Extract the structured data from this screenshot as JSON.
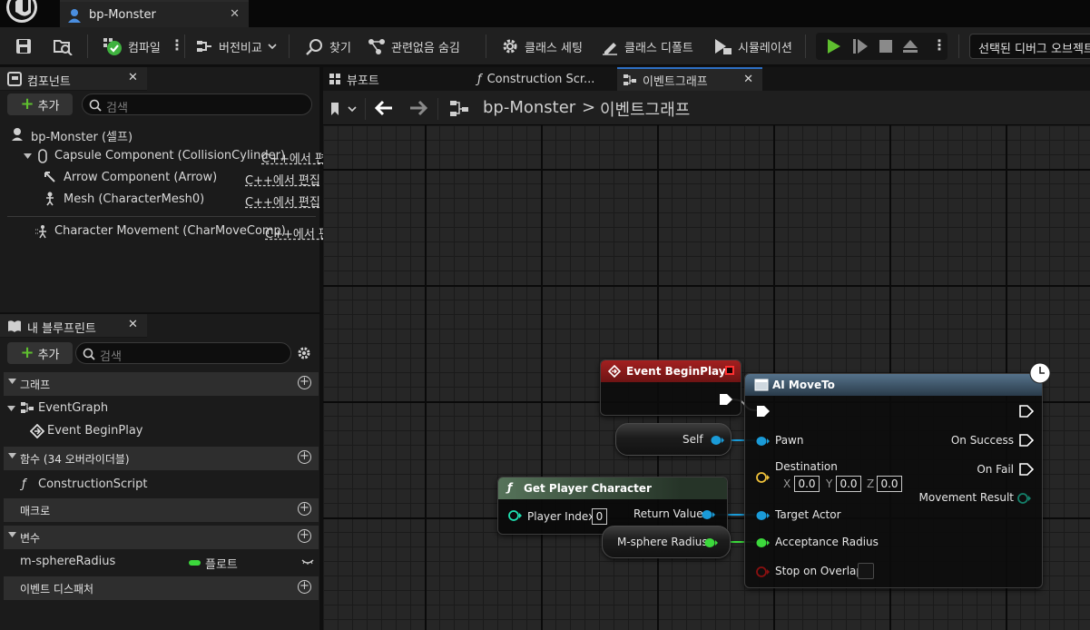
{
  "window": {
    "doc_tab": "bp-Monster"
  },
  "toolbar": {
    "compile": "컴파일",
    "diff": "버전비교",
    "find": "찾기",
    "hide_unrelated": "관련없음 숨김",
    "class_settings": "클래스 세팅",
    "class_defaults": "클래스 디폴트",
    "simulation": "시뮬레이션",
    "debug_select": "선택된 디버그 오브젝트"
  },
  "components": {
    "tab": "컴포넌트",
    "add": "추가",
    "search_placeholder": "검색",
    "items": [
      {
        "label": "bp-Monster (셀프)",
        "edit": ""
      },
      {
        "label": "Capsule Component (CollisionCylinder)",
        "edit": "C++에서 편"
      },
      {
        "label": "Arrow Component (Arrow)",
        "edit": "C++에서 편집"
      },
      {
        "label": "Mesh (CharacterMesh0)",
        "edit": "C++에서 편집"
      },
      {
        "label": "Character Movement (CharMoveComp)",
        "edit": "C++에서 편"
      }
    ]
  },
  "my_blueprint": {
    "tab": "내 블루프린트",
    "add": "추가",
    "search_placeholder": "검색",
    "sections": {
      "graphs": "그래프",
      "functions": "함수 (34 오버라이더블)",
      "macros": "매크로",
      "variables": "변수",
      "dispatchers": "이벤트 디스패처"
    },
    "graph_items": [
      "EventGraph",
      "Event BeginPlay"
    ],
    "function_items": [
      "ConstructionScript"
    ],
    "variable": {
      "name": "m-sphereRadius",
      "type": "플로트",
      "type_color": "#3cd93c"
    }
  },
  "graph_tabs": [
    "뷰포트",
    "Construction Scr...",
    "이벤트그래프"
  ],
  "breadcrumb": {
    "root": "bp-Monster",
    "sep": ">",
    "current": "이벤트그래프"
  },
  "nodes": {
    "begin_play": {
      "title": "Event BeginPlay",
      "color": "#8b1a1a"
    },
    "self": {
      "label": "Self"
    },
    "get_player": {
      "title": "Get Player Character",
      "player_index_label": "Player Index",
      "player_index": "0",
      "return_value": "Return Value"
    },
    "m_sphere": {
      "label": "M-sphere Radius"
    },
    "ai_move": {
      "title": "AI MoveTo",
      "pawn": "Pawn",
      "destination": "Destination",
      "dest_x_label": "X",
      "dest_x": "0.0",
      "dest_y_label": "Y",
      "dest_y": "0.0",
      "dest_z_label": "Z",
      "dest_z": "0.0",
      "target_actor": "Target Actor",
      "acceptance_radius": "Acceptance Radius",
      "stop_on_overlap": "Stop on Overlap",
      "on_success": "On Success",
      "on_fail": "On Fail",
      "movement_result": "Movement Result"
    }
  },
  "colors": {
    "object_pin": "#1a9bd8",
    "float_pin": "#3cd93c",
    "vector_pin": "#f0c23a",
    "bool_pin": "#8a1010",
    "exec": "#ffffff",
    "enum_pin": "#0f6a5a"
  }
}
